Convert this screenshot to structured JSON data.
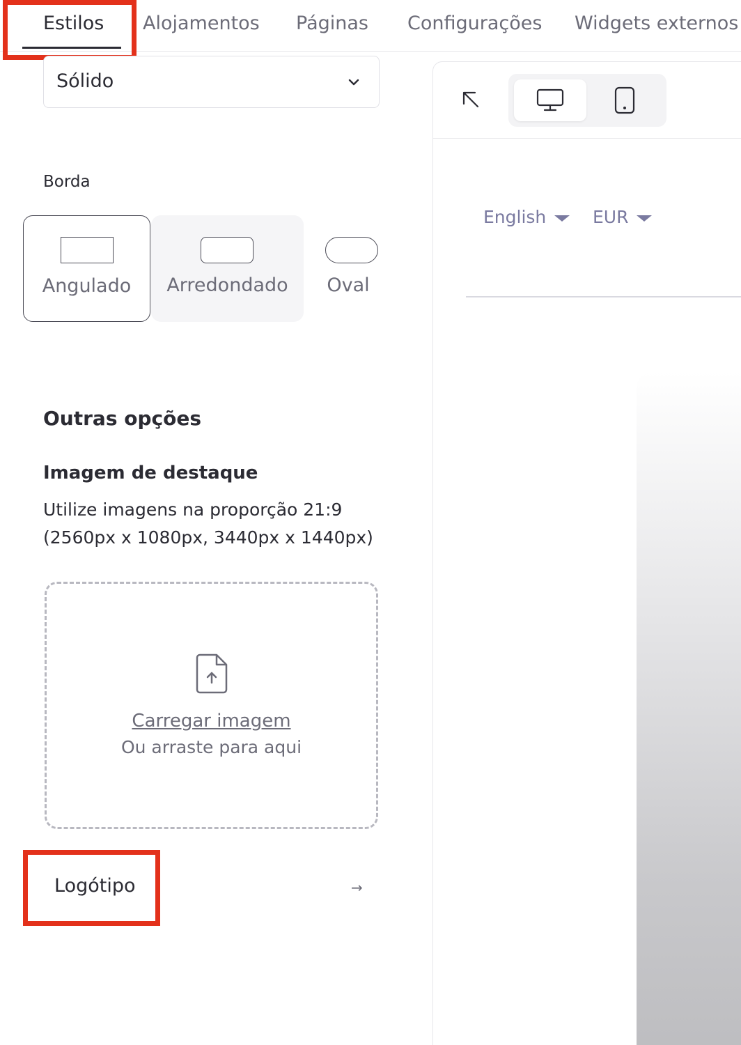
{
  "tabs": [
    {
      "label": "Estilos",
      "active": true
    },
    {
      "label": "Alojamentos"
    },
    {
      "label": "Páginas"
    },
    {
      "label": "Configurações"
    },
    {
      "label": "Widgets externos"
    }
  ],
  "style_select": {
    "value": "Sólido"
  },
  "border": {
    "label": "Borda",
    "options": [
      {
        "label": "Angulado",
        "selected": true
      },
      {
        "label": "Arredondado"
      },
      {
        "label": "Oval"
      }
    ]
  },
  "other_options": {
    "title": "Outras opções",
    "featured_image": {
      "title": "Imagem de destaque",
      "description": "Utilize imagens na proporção 21:9 (2560px x 1080px, 3440px x 1440px)",
      "upload_link": "Carregar imagem",
      "upload_hint": "Ou arraste para aqui"
    },
    "logo": {
      "label": "Logótipo",
      "arrow": "→"
    }
  },
  "preview": {
    "language": "English",
    "currency": "EUR",
    "device": "desktop"
  },
  "colors": {
    "highlight": "#e3311b",
    "accent_text": "#7a7aa0"
  }
}
